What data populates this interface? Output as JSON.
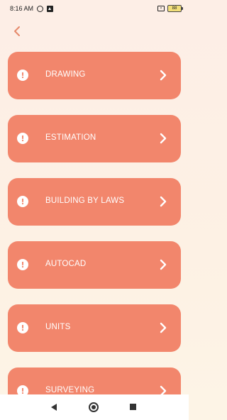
{
  "status_bar": {
    "time": "8:16 AM",
    "battery_level": "88"
  },
  "back_icon": "chevron-left-icon",
  "menu": {
    "items": [
      {
        "label": "DRAWING"
      },
      {
        "label": "ESTIMATION"
      },
      {
        "label": "BUILDING BY LAWS"
      },
      {
        "label": "AUTOCAD"
      },
      {
        "label": "UNITS"
      },
      {
        "label": "SURVEYING"
      }
    ]
  },
  "colors": {
    "card": "#f2866c",
    "accent_back": "#e5886a",
    "background_top": "#fdeee6",
    "background_bottom": "#fdf4e6"
  }
}
